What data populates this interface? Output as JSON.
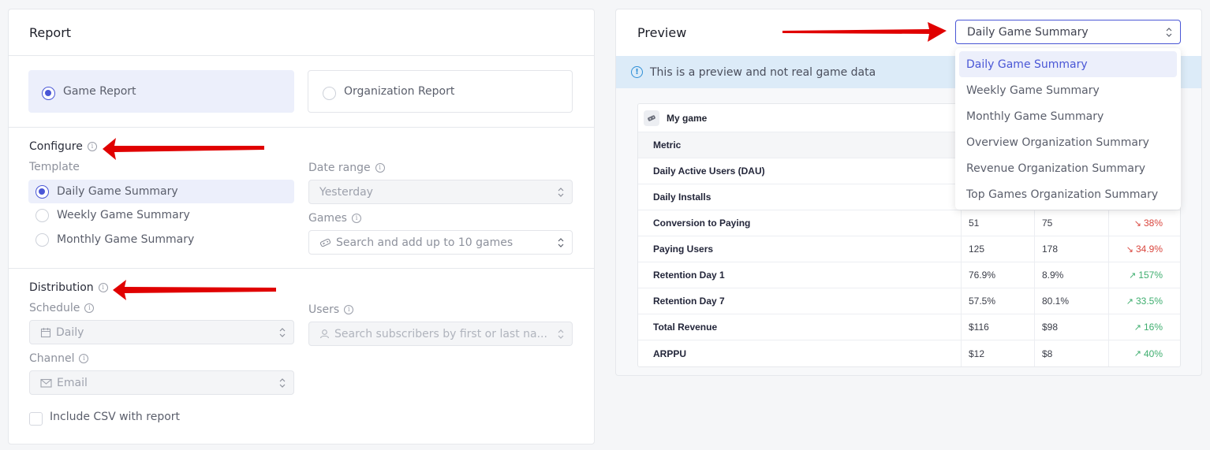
{
  "report": {
    "title": "Report",
    "types": [
      {
        "label": "Game Report",
        "selected": true
      },
      {
        "label": "Organization Report",
        "selected": false
      }
    ]
  },
  "configure": {
    "title": "Configure",
    "template_label": "Template",
    "templates": [
      {
        "label": "Daily Game Summary",
        "selected": true
      },
      {
        "label": "Weekly Game Summary",
        "selected": false
      },
      {
        "label": "Monthly Game Summary",
        "selected": false
      }
    ],
    "date_range_label": "Date range",
    "date_range_value": "Yesterday",
    "games_label": "Games",
    "games_placeholder": "Search and add up to 10 games"
  },
  "distribution": {
    "title": "Distribution",
    "schedule_label": "Schedule",
    "schedule_value": "Daily",
    "users_label": "Users",
    "users_placeholder": "Search subscribers by first or last na...",
    "channel_label": "Channel",
    "channel_value": "Email",
    "include_csv_label": "Include CSV with report",
    "include_csv_checked": false
  },
  "preview": {
    "title": "Preview",
    "banner": "This is a preview and not real game data",
    "template_select": {
      "value": "Daily Game Summary",
      "options": [
        "Daily Game Summary",
        "Weekly Game Summary",
        "Monthly Game Summary",
        "Overview Organization Summary",
        "Revenue Organization Summary",
        "Top Games Organization Summary"
      ]
    },
    "table": {
      "game_name": "My game",
      "header": {
        "metric": "Metric"
      },
      "rows": [
        {
          "metric": "Daily Active Users (DAU)",
          "current": "",
          "previous": "",
          "change": "",
          "direction": ""
        },
        {
          "metric": "Daily Installs",
          "current": "",
          "previous": "",
          "change": "",
          "direction": ""
        },
        {
          "metric": "Conversion to Paying",
          "current": "51",
          "previous": "75",
          "change": "38%",
          "direction": "down"
        },
        {
          "metric": "Paying Users",
          "current": "125",
          "previous": "178",
          "change": "34.9%",
          "direction": "down"
        },
        {
          "metric": "Retention Day 1",
          "current": "76.9%",
          "previous": "8.9%",
          "change": "157%",
          "direction": "up"
        },
        {
          "metric": "Retention Day 7",
          "current": "57.5%",
          "previous": "80.1%",
          "change": "33.5%",
          "direction": "up"
        },
        {
          "metric": "Total Revenue",
          "current": "$116",
          "previous": "$98",
          "change": "16%",
          "direction": "up"
        },
        {
          "metric": "ARPPU",
          "current": "$12",
          "previous": "$8",
          "change": "40%",
          "direction": "up"
        }
      ]
    }
  },
  "colors": {
    "accent": "#4a57d6",
    "selected_bg": "#eceffb",
    "banner_bg": "#dcebf8",
    "down": "#d9463e",
    "up": "#3fae6f",
    "annotation_arrow": "#e00000"
  }
}
